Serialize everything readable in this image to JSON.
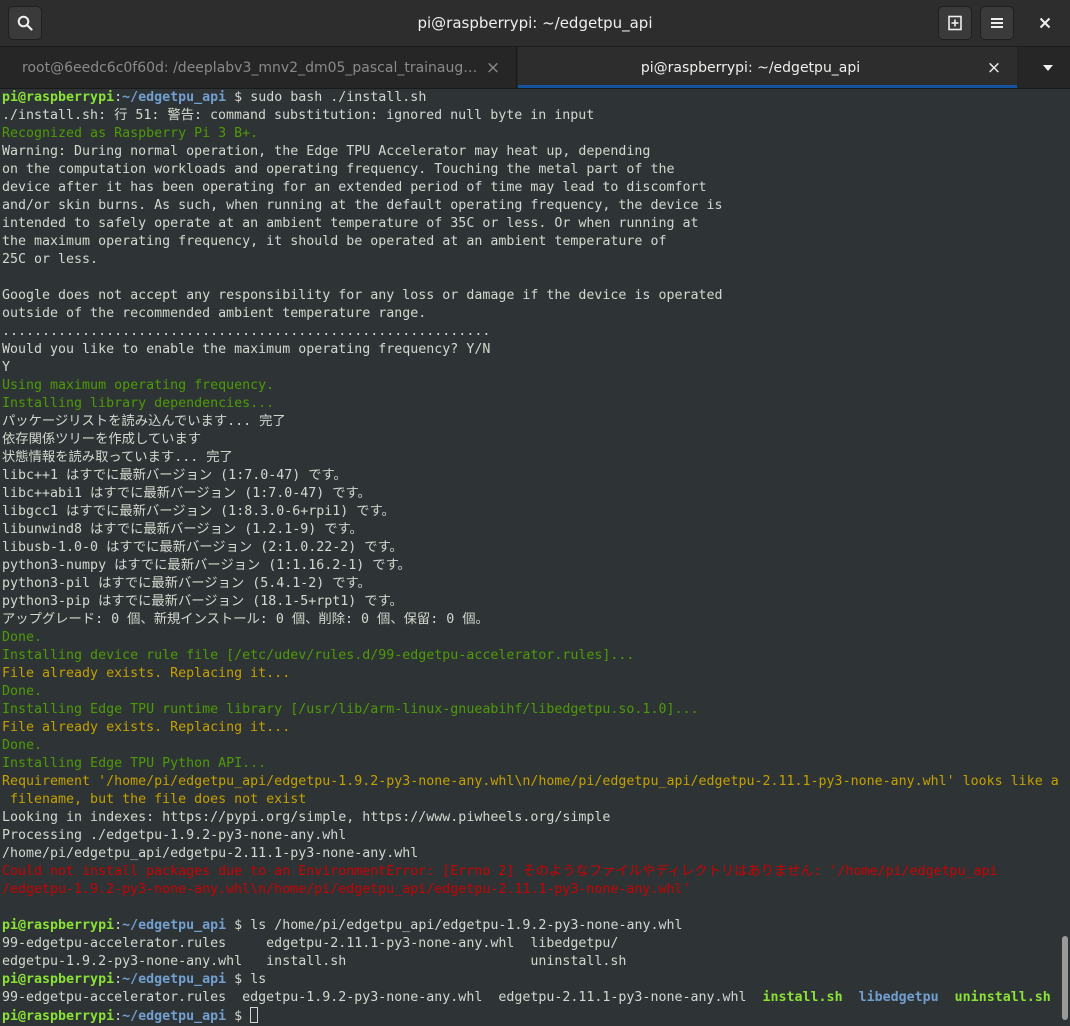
{
  "window": {
    "title": "pi@raspberrypi: ~/edgetpu_api"
  },
  "header": {
    "search_icon": "search-icon",
    "new_tab_icon": "new-tab-icon",
    "menu_icon": "hamburger-menu-icon",
    "close_icon": "close-icon"
  },
  "tabs": [
    {
      "label": "root@6eedc6c0f60d: /deeplabv3_mnv2_dm05_pascal_trainaug_...",
      "active": false
    },
    {
      "label": "pi@raspberrypi: ~/edgetpu_api",
      "active": true
    }
  ],
  "colors": {
    "accent": "#15539e",
    "background": "#2e3436",
    "green": "#4e9a06",
    "yellow": "#c4a000",
    "red": "#cc0000"
  },
  "terminal": {
    "prompt_user": "pi@raspberrypi",
    "prompt_path": "~/edgetpu_api",
    "prompt_suffix": " $ ",
    "cmd1": "sudo bash ./install.sh",
    "l02": "./install.sh: 行 51: 警告: command substitution: ignored null byte in input",
    "l03": "Recognized as Raspberry Pi 3 B+.",
    "l04": "Warning: During normal operation, the Edge TPU Accelerator may heat up, depending",
    "l05": "on the computation workloads and operating frequency. Touching the metal part of the",
    "l06": "device after it has been operating for an extended period of time may lead to discomfort",
    "l07": "and/or skin burns. As such, when running at the default operating frequency, the device is",
    "l08": "intended to safely operate at an ambient temperature of 35C or less. Or when running at",
    "l09": "the maximum operating frequency, it should be operated at an ambient temperature of",
    "l10": "25C or less.",
    "l12": "Google does not accept any responsibility for any loss or damage if the device is operated",
    "l13": "outside of the recommended ambient temperature range.",
    "l14": ".............................................................",
    "l15": "Would you like to enable the maximum operating frequency? Y/N",
    "l16": "Y",
    "l17": "Using maximum operating frequency.",
    "l18": "Installing library dependencies...",
    "l19": "パッケージリストを読み込んでいます... 完了",
    "l20": "依存関係ツリーを作成しています",
    "l21": "状態情報を読み取っています... 完了",
    "l22": "libc++1 はすでに最新バージョン (1:7.0-47) です。",
    "l23": "libc++abi1 はすでに最新バージョン (1:7.0-47) です。",
    "l24": "libgcc1 はすでに最新バージョン (1:8.3.0-6+rpi1) です。",
    "l25": "libunwind8 はすでに最新バージョン (1.2.1-9) です。",
    "l26": "libusb-1.0-0 はすでに最新バージョン (2:1.0.22-2) です。",
    "l27": "python3-numpy はすでに最新バージョン (1:1.16.2-1) です。",
    "l28": "python3-pil はすでに最新バージョン (5.4.1-2) です。",
    "l29": "python3-pip はすでに最新バージョン (18.1-5+rpt1) です。",
    "l30": "アップグレード: 0 個、新規インストール: 0 個、削除: 0 個、保留: 0 個。",
    "l31": "Done.",
    "l32": "Installing device rule file [/etc/udev/rules.d/99-edgetpu-accelerator.rules]...",
    "l33": "File already exists. Replacing it...",
    "l34": "Done.",
    "l35": "Installing Edge TPU runtime library [/usr/lib/arm-linux-gnueabihf/libedgetpu.so.1.0]...",
    "l36": "File already exists. Replacing it...",
    "l37": "Done.",
    "l38": "Installing Edge TPU Python API...",
    "l39": "Requirement '/home/pi/edgetpu_api/edgetpu-1.9.2-py3-none-any.whl\\n/home/pi/edgetpu_api/edgetpu-2.11.1-py3-none-any.whl' looks like a",
    "l40": " filename, but the file does not exist",
    "l41": "Looking in indexes: https://pypi.org/simple, https://www.piwheels.org/simple",
    "l42": "Processing ./edgetpu-1.9.2-py3-none-any.whl",
    "l43": "/home/pi/edgetpu_api/edgetpu-2.11.1-py3-none-any.whl",
    "l44": "Could not install packages due to an EnvironmentError: [Errno 2] そのようなファイルやディレクトリはありません: '/home/pi/edgetpu_api",
    "l45": "/edgetpu-1.9.2-py3-none-any.whl\\n/home/pi/edgetpu_api/edgetpu-2.11.1-py3-none-any.whl'",
    "cmd2": "ls /home/pi/edgetpu_api/edgetpu-1.9.2-py3-none-any.whl",
    "l48": "99-edgetpu-accelerator.rules     edgetpu-2.11.1-py3-none-any.whl  libedgetpu/",
    "l49": "edgetpu-1.9.2-py3-none-any.whl   install.sh                       uninstall.sh",
    "cmd3": "ls",
    "ls_plain": "99-edgetpu-accelerator.rules  edgetpu-1.9.2-py3-none-any.whl  edgetpu-2.11.1-py3-none-any.whl  ",
    "ls_install": "install.sh",
    "ls_lib": "libedgetpu",
    "ls_uninstall": "uninstall.sh"
  }
}
